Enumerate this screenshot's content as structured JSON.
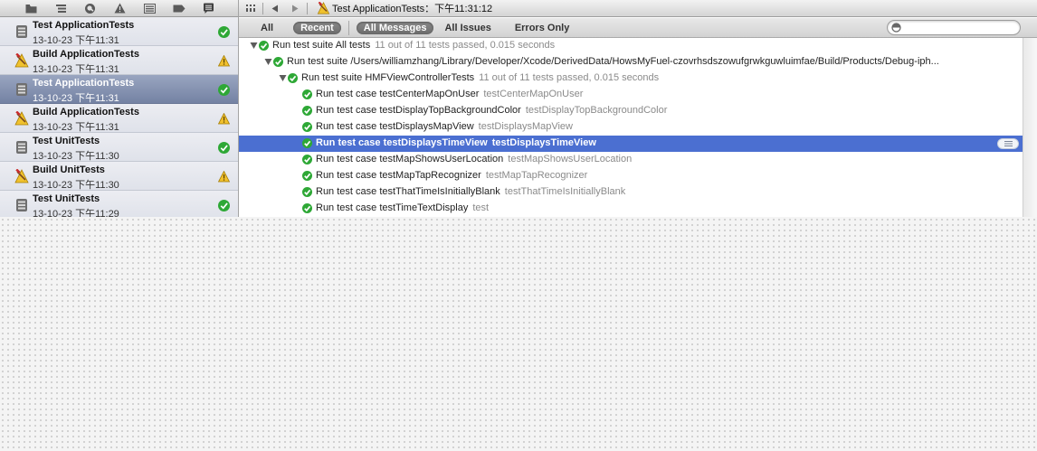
{
  "navigator": {
    "toolbar_icons": [
      "folder-icon",
      "hierarchy-icon",
      "search-icon",
      "warning-icon",
      "list-icon",
      "breakpoint-icon",
      "log-icon"
    ],
    "logs": [
      {
        "kind": "test",
        "title": "Test ApplicationTests",
        "date": "13-10-23 下午11:31",
        "status": "success",
        "selected": false
      },
      {
        "kind": "build",
        "title": "Build ApplicationTests",
        "date": "13-10-23 下午11:31",
        "status": "warning",
        "selected": false
      },
      {
        "kind": "test",
        "title": "Test ApplicationTests",
        "date": "13-10-23 下午11:31",
        "status": "success",
        "selected": true
      },
      {
        "kind": "build",
        "title": "Build ApplicationTests",
        "date": "13-10-23 下午11:31",
        "status": "warning",
        "selected": false
      },
      {
        "kind": "test",
        "title": "Test UnitTests",
        "date": "13-10-23 下午11:30",
        "status": "success",
        "selected": false
      },
      {
        "kind": "build",
        "title": "Build UnitTests",
        "date": "13-10-23 下午11:30",
        "status": "warning",
        "selected": false
      },
      {
        "kind": "test",
        "title": "Test UnitTests",
        "date": "13-10-23 下午11:29",
        "status": "success",
        "selected": false
      }
    ]
  },
  "jumpbar": {
    "breadcrumb": "Test ApplicationTests：下午11:31:12"
  },
  "filters": {
    "buttons": [
      {
        "label": "All",
        "active": false
      },
      {
        "label": "Recent",
        "active": true
      },
      {
        "label": "All Messages",
        "active": true
      },
      {
        "label": "All Issues",
        "active": false
      },
      {
        "label": "Errors Only",
        "active": false
      }
    ],
    "search_value": "",
    "search_placeholder": ""
  },
  "tree": [
    {
      "level": 0,
      "disclosure": true,
      "text": "Run test suite All tests",
      "detail": "11 out of 11 tests passed, 0.015 seconds",
      "selected": false
    },
    {
      "level": 1,
      "disclosure": true,
      "text": "Run test suite /Users/williamzhang/Library/Developer/Xcode/DerivedData/HowsMyFuel-czovrhsdszowufgrwkguwluimfae/Build/Products/Debug-iph...",
      "detail": "",
      "selected": false
    },
    {
      "level": 2,
      "disclosure": true,
      "text": "Run test suite HMFViewControllerTests",
      "detail": "11 out of 11 tests passed, 0.015 seconds",
      "selected": false
    },
    {
      "level": 3,
      "disclosure": false,
      "text": "Run test case testCenterMapOnUser",
      "detail": "testCenterMapOnUser",
      "selected": false
    },
    {
      "level": 3,
      "disclosure": false,
      "text": "Run test case testDisplayTopBackgroundColor",
      "detail": "testDisplayTopBackgroundColor",
      "selected": false
    },
    {
      "level": 3,
      "disclosure": false,
      "text": "Run test case testDisplaysMapView",
      "detail": "testDisplaysMapView",
      "selected": false
    },
    {
      "level": 3,
      "disclosure": false,
      "text": "Run test case testDisplaysTimeView",
      "detail": "testDisplaysTimeView",
      "selected": true
    },
    {
      "level": 3,
      "disclosure": false,
      "text": "Run test case testMapShowsUserLocation",
      "detail": "testMapShowsUserLocation",
      "selected": false
    },
    {
      "level": 3,
      "disclosure": false,
      "text": "Run test case testMapTapRecognizer",
      "detail": "testMapTapRecognizer",
      "selected": false
    },
    {
      "level": 3,
      "disclosure": false,
      "text": "Run test case testThatTimeIsInitiallyBlank",
      "detail": "testThatTimeIsInitiallyBlank",
      "selected": false
    },
    {
      "level": 3,
      "disclosure": false,
      "text": "Run test case testTimeTextDisplay",
      "detail": "test",
      "selected": false
    }
  ],
  "colors": {
    "selection_blue": "#4b6fd1",
    "pass_green": "#2ea836",
    "warning_yellow": "#f2c12e"
  }
}
